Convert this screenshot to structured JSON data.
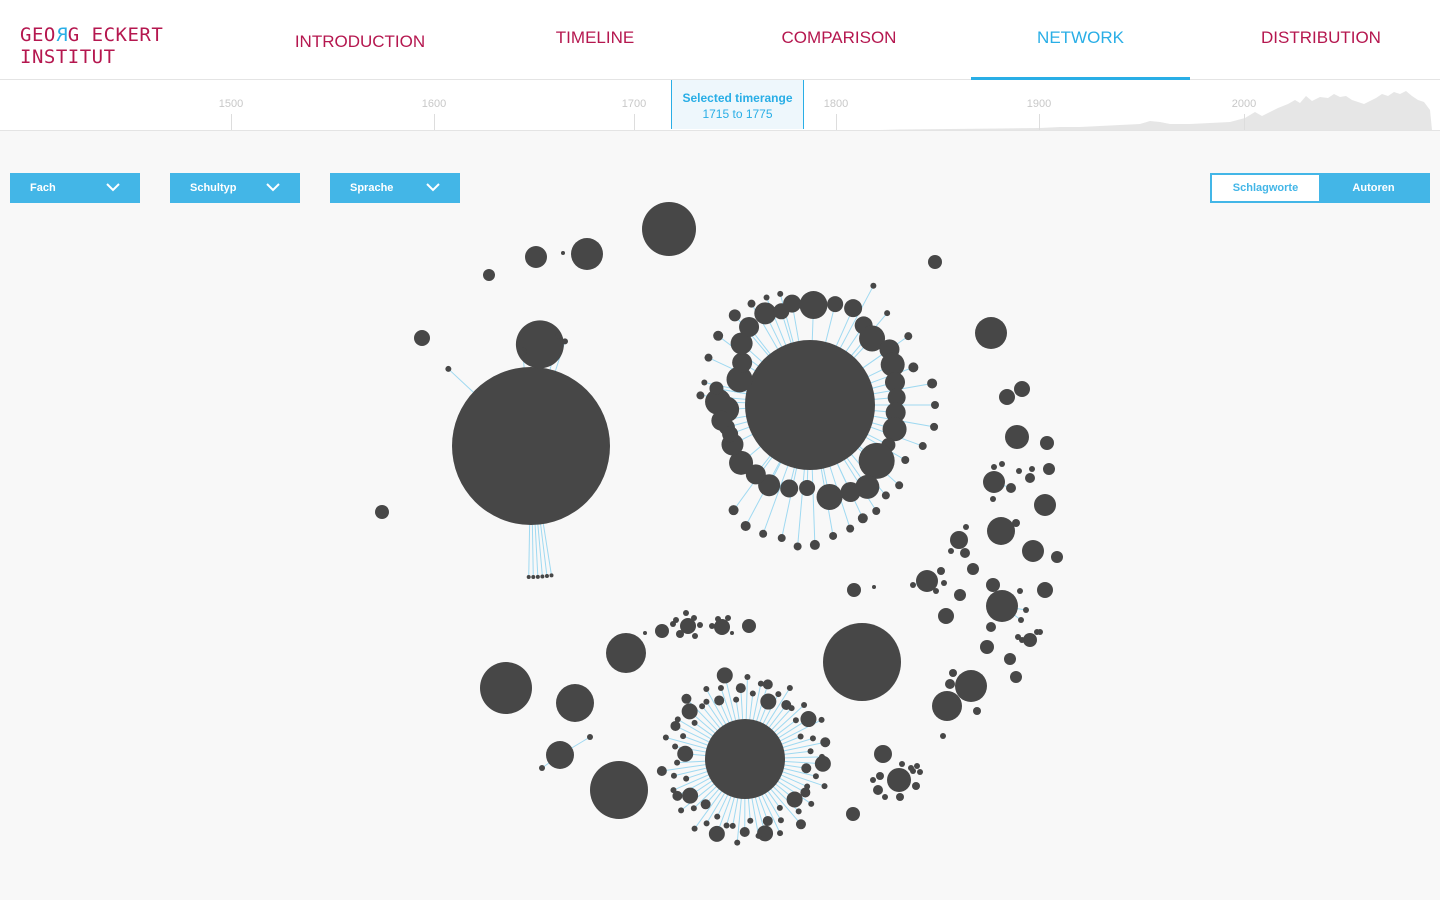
{
  "logo": {
    "line1_a": "GEO",
    "line1_r": "R",
    "line1_b": "G ECKERT",
    "line2": "INSTITUT"
  },
  "nav": [
    {
      "label": "INTRODUCTION",
      "active": false
    },
    {
      "label": "TIMELINE",
      "active": false
    },
    {
      "label": "COMPARISON",
      "active": false
    },
    {
      "label": "NETWORK",
      "active": true
    },
    {
      "label": "DISTRIBUTION",
      "active": false
    }
  ],
  "timeline": {
    "ticks": [
      "1500",
      "1600",
      "1700",
      "1800",
      "1900",
      "2000"
    ],
    "selected_title": "Selected timerange",
    "selected_range": "1715 to 1775"
  },
  "filters": [
    {
      "label": "Fach",
      "icon": "chevron-down-icon"
    },
    {
      "label": "Schultyp",
      "icon": "chevron-down-icon"
    },
    {
      "label": "Sprache",
      "icon": "chevron-down-icon"
    }
  ],
  "toggle": {
    "option_a": "Schlagworte",
    "option_b": "Autoren",
    "selected": "Schlagworte"
  },
  "colors": {
    "brand": "#b5174f",
    "accent": "#29aee6",
    "node": "#474747",
    "link": "#9fd9f1"
  }
}
